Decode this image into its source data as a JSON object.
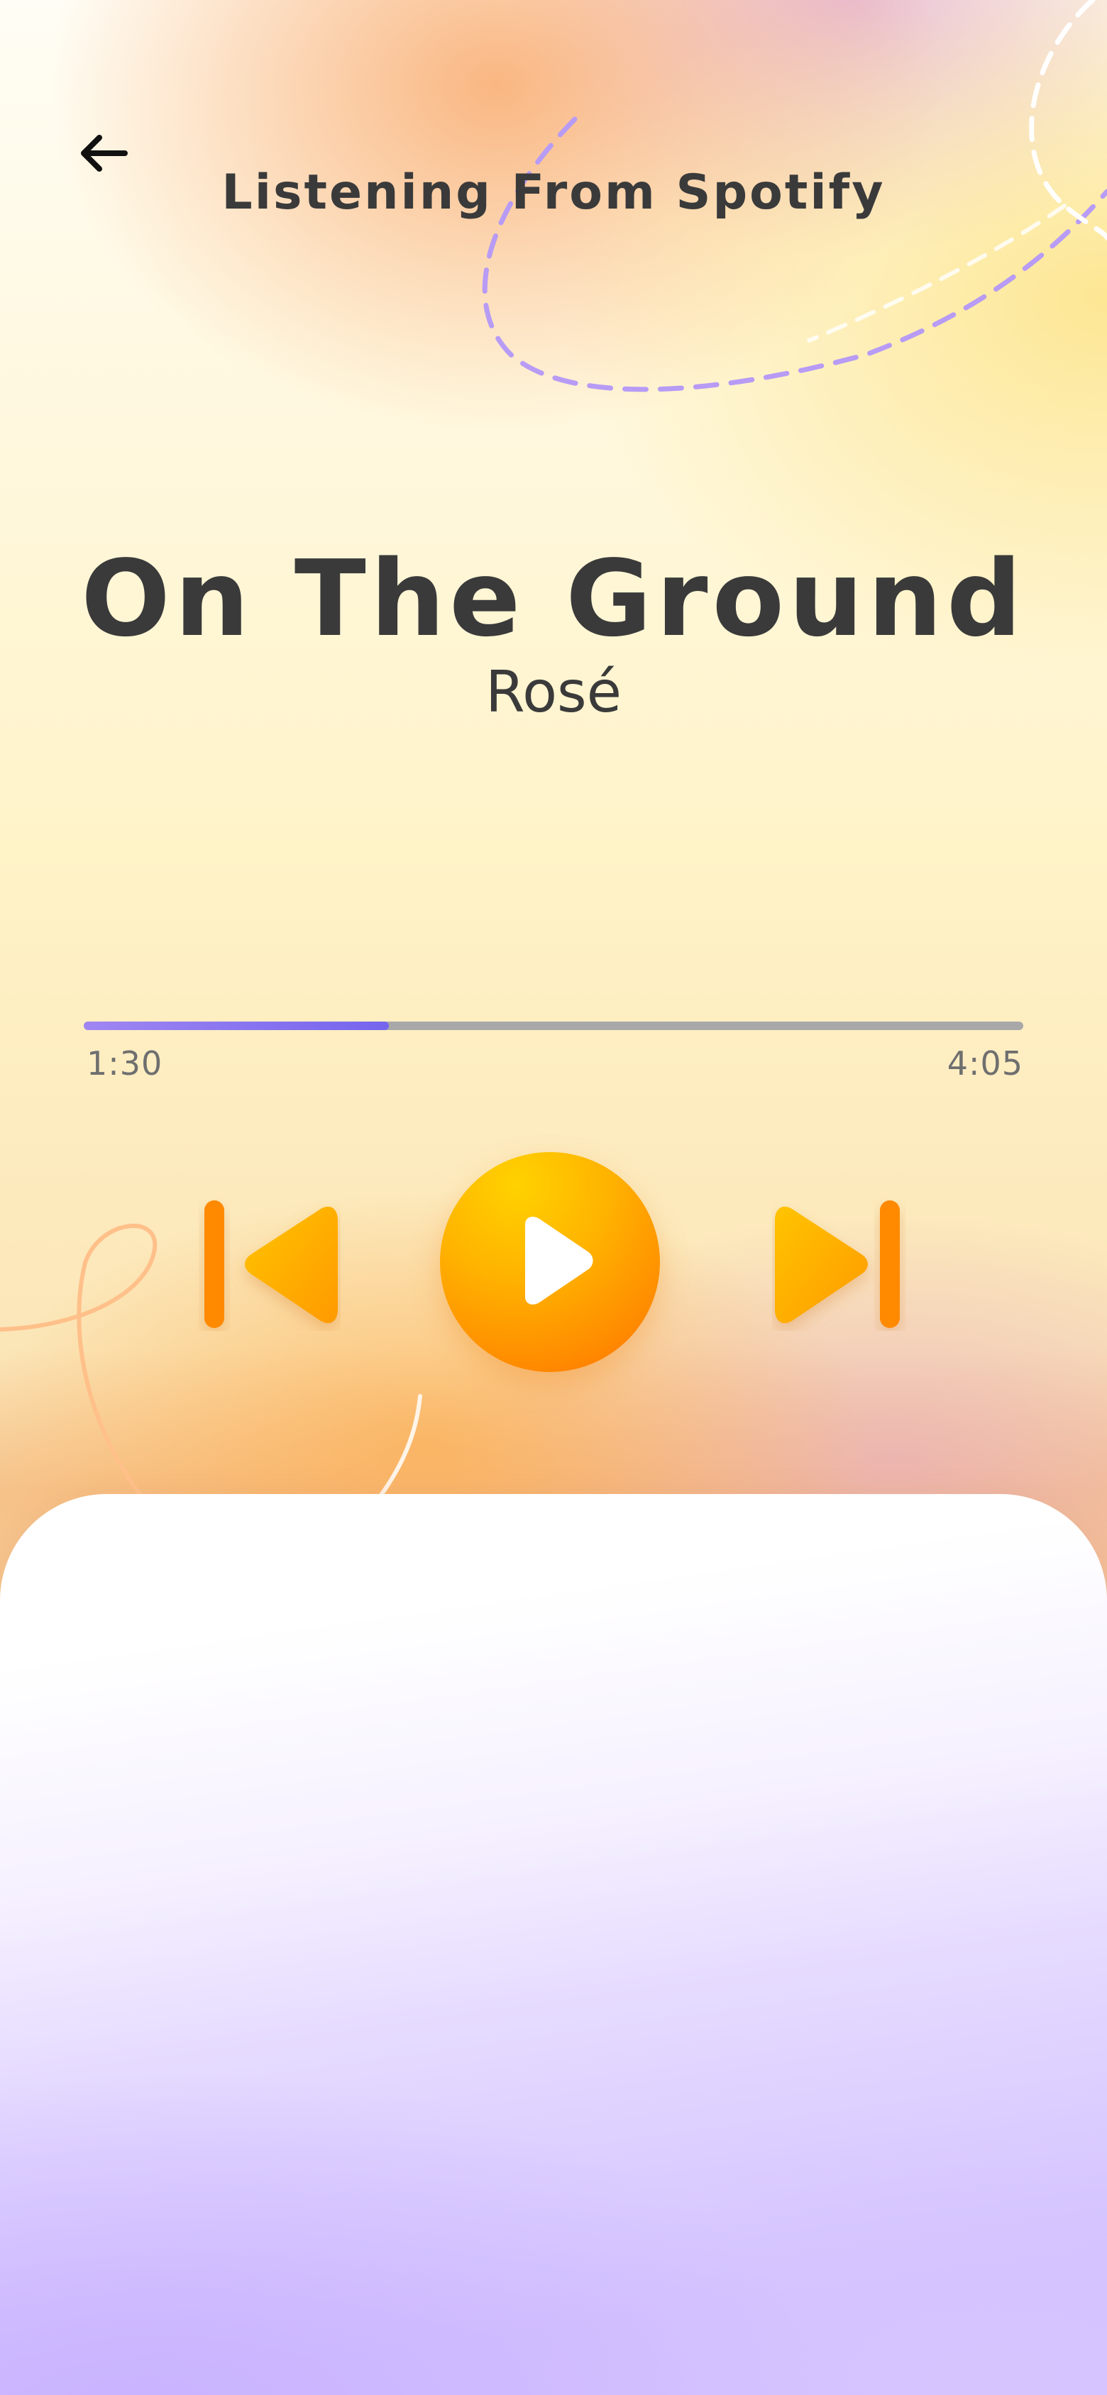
{
  "header": {
    "title": "Listening From Spotify"
  },
  "track": {
    "title": "On The Ground",
    "artist": "Rosé"
  },
  "progress": {
    "elapsed": "1:30",
    "total": "4:05",
    "fraction": 0.325
  },
  "colors": {
    "accent_orange": "#ff8a00",
    "accent_yellow": "#ffc400",
    "progress_fill": "#7f6cf0",
    "progress_track": "#a8a8a8",
    "text_dark": "#3a3a3a",
    "sheet_lavender": "#d3c2ff"
  },
  "icons": {
    "back": "arrow-left-icon",
    "previous": "skip-previous-icon",
    "play": "play-icon",
    "next": "skip-next-icon"
  }
}
